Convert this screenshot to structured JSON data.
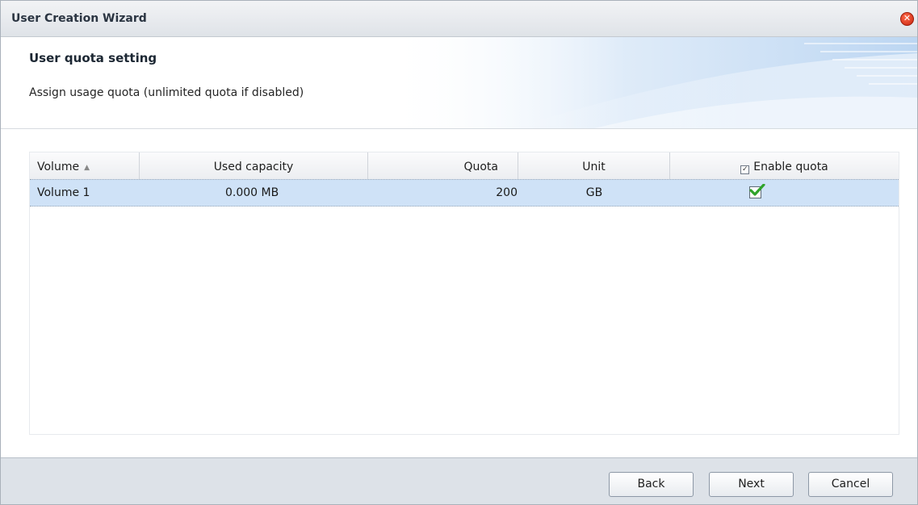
{
  "window": {
    "title": "User Creation Wizard"
  },
  "header": {
    "title": "User quota setting",
    "description": "Assign usage quota (unlimited quota if disabled)"
  },
  "grid": {
    "columns": {
      "volume": "Volume",
      "used_capacity": "Used capacity",
      "quota": "Quota",
      "unit": "Unit",
      "enable_quota": "Enable quota"
    },
    "sort": {
      "column": "Volume",
      "direction": "ascending"
    },
    "header_enable_quota_checked": true,
    "rows": [
      {
        "volume": "Volume 1",
        "used_capacity": "0.000 MB",
        "quota": "200",
        "unit": "GB",
        "enable_quota": true,
        "selected": true
      }
    ]
  },
  "footer": {
    "back": "Back",
    "next": "Next",
    "cancel": "Cancel"
  },
  "colors": {
    "selected_row": "#cfe2f7",
    "footer_bg": "#dde2e8",
    "check_green": "#2fa32a",
    "close_red": "#d8321b"
  }
}
